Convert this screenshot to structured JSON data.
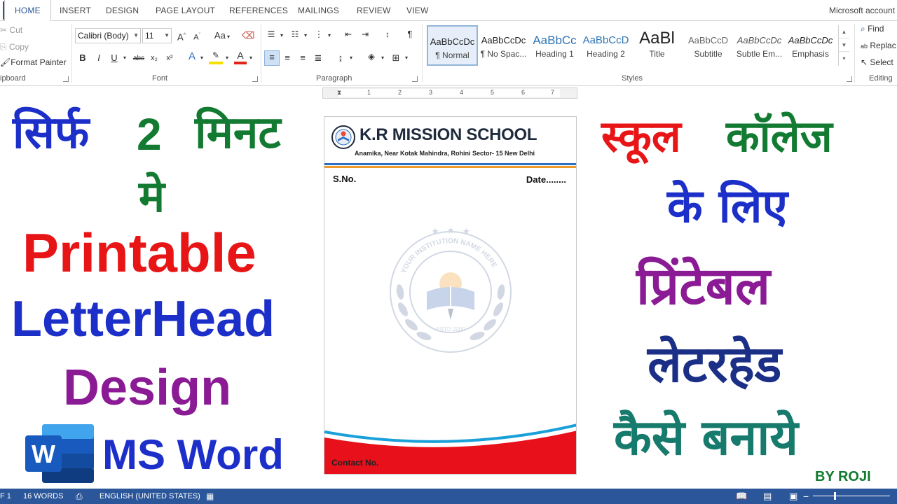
{
  "tabs": [
    "HOME",
    "INSERT",
    "DESIGN",
    "PAGE LAYOUT",
    "REFERENCES",
    "MAILINGS",
    "REVIEW",
    "VIEW"
  ],
  "account": "Microsoft account",
  "clipboard": {
    "cut": "Cut",
    "copy": "Copy",
    "format_painter": "Format Painter",
    "label": "ipboard"
  },
  "font": {
    "name": "Calibri (Body)",
    "size": "11",
    "label": "Font",
    "case_button": "Aa",
    "bold": "B",
    "italic": "I",
    "underline": "U",
    "strikethrough": "abc",
    "subscript": "x₂",
    "superscript": "x²",
    "grow": "A",
    "shrink": "A",
    "effects": "A",
    "font_color": "A"
  },
  "paragraph": {
    "label": "Paragraph"
  },
  "styles": {
    "label": "Styles",
    "items": [
      {
        "sample": "AaBbCcDc",
        "name": "¶ Normal"
      },
      {
        "sample": "AaBbCcDc",
        "name": "¶ No Spac..."
      },
      {
        "sample": "AaBbCc",
        "name": "Heading 1"
      },
      {
        "sample": "AaBbCcD",
        "name": "Heading 2"
      },
      {
        "sample": "AaBl",
        "name": "Title"
      },
      {
        "sample": "AaBbCcD",
        "name": "Subtitle"
      },
      {
        "sample": "AaBbCcDc",
        "name": "Subtle Em..."
      },
      {
        "sample": "AaBbCcDc",
        "name": "Emphasis"
      }
    ]
  },
  "editing": {
    "find": "Find",
    "replace": "Replac",
    "select": "Select",
    "label": "Editing"
  },
  "ruler": [
    "1",
    "1",
    "2",
    "3",
    "4",
    "5",
    "6",
    "7"
  ],
  "thumbnail": {
    "left": {
      "line1a": "सिर्फ",
      "line1b": "2",
      "line1c": "मिनट",
      "line2": "मे",
      "line3": "Printable",
      "line4": "LetterHead",
      "line5": "Design",
      "line6": "MS Word"
    },
    "right": {
      "line1a": "स्कूल",
      "line1b": "कॉलेज",
      "line2": "के लिए",
      "line3": "प्रिंटेबल",
      "line4": "लेटरहेड",
      "line5": "कैसे बनाये",
      "credit": "BY ROJI"
    },
    "colors": {
      "blue": "#1c2fc9",
      "green": "#127a31",
      "red": "#e81517",
      "purple": "#8b1a95",
      "dark_blue": "#1b2f86",
      "teal": "#167a6c"
    }
  },
  "letterhead": {
    "school_name": "K.R MISSION SCHOOL",
    "address": "Anamika, Near Kotak Mahindra, Rohini Sector- 15 New Delhi",
    "sno": "S.No.",
    "date": "Date........",
    "contact": "Contact No.",
    "watermark_ring_text": "YOUR INSTITUTION NAME HERE",
    "watermark_estd": "ESTD 2000"
  },
  "status": {
    "page": "F 1",
    "words": "16 WORDS",
    "language": "ENGLISH (UNITED STATES)"
  }
}
